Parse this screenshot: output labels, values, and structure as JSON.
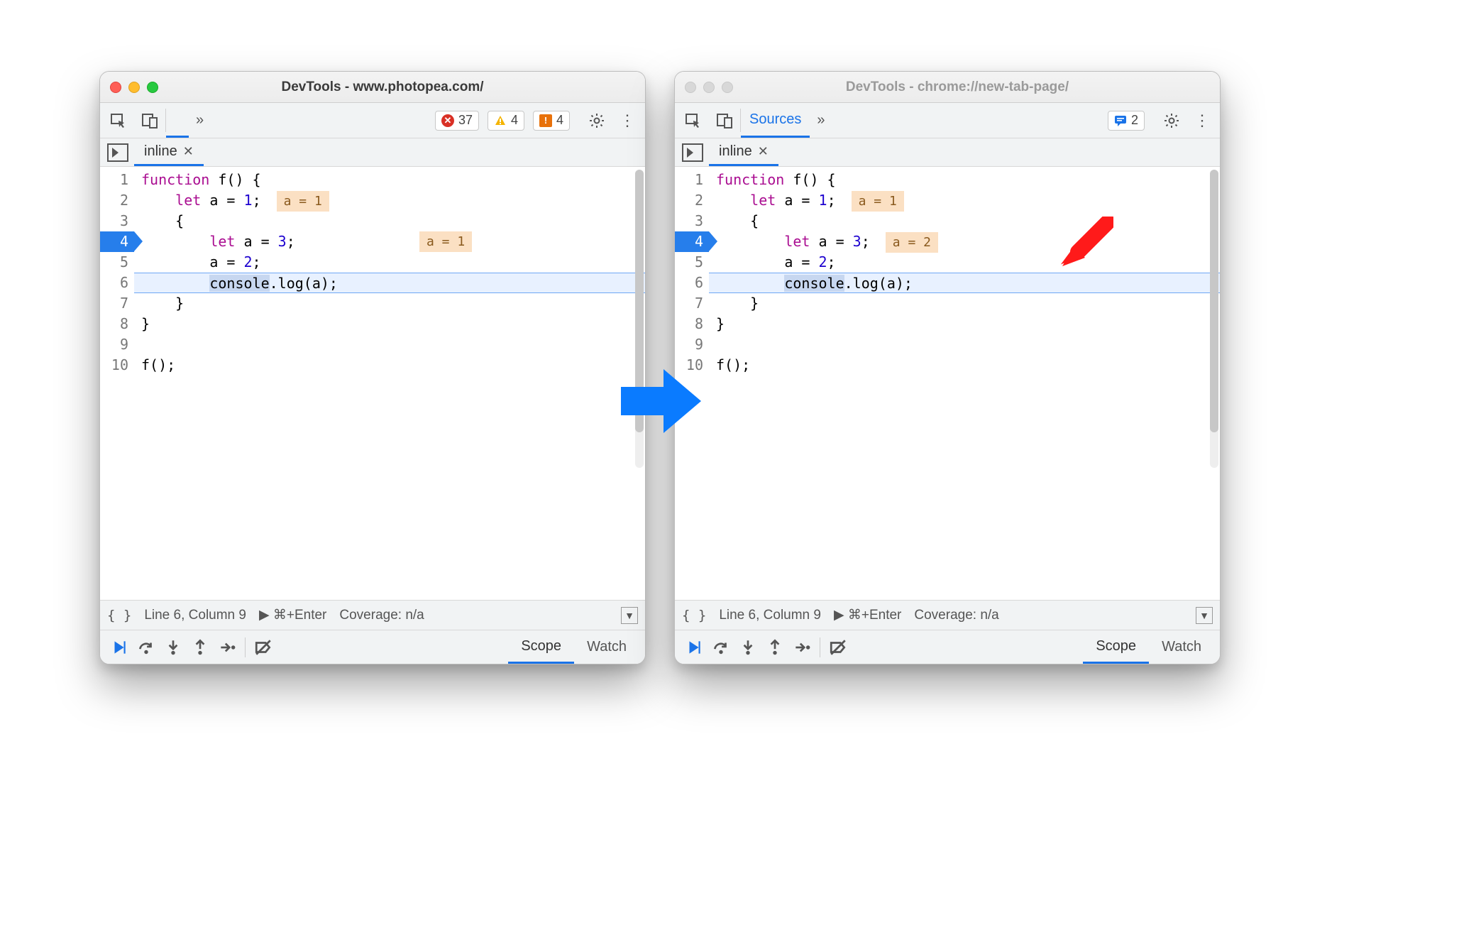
{
  "windows": [
    {
      "active": true,
      "title": "DevTools - www.photopea.com/",
      "toolbar": {
        "show_sources_tab": false,
        "badges": [
          {
            "kind": "err",
            "count": "37"
          },
          {
            "kind": "warn",
            "count": "4"
          },
          {
            "kind": "issue",
            "count": "4"
          }
        ]
      },
      "file_tab": "inline",
      "code": {
        "lines": [
          "1",
          "2",
          "3",
          "4",
          "5",
          "6",
          "7",
          "8",
          "9",
          "10"
        ],
        "bp_line": "4",
        "tok": {
          "kw_function": "function",
          "fn_name": "f",
          "kw_let": "let",
          "v_a": "a",
          "n1": "1",
          "n3": "3",
          "n2": "2",
          "console": "console",
          "log": "log",
          "callarg": "a",
          "call_f": "f"
        },
        "inline_vals": {
          "l2": "a = 1",
          "l4": "a = 1"
        },
        "inline4_far": true
      },
      "status": {
        "pos": "Line 6, Column 9",
        "run": "⌘+Enter",
        "cov": "Coverage: n/a"
      },
      "panels": {
        "scope": "Scope",
        "watch": "Watch"
      }
    },
    {
      "active": false,
      "title": "DevTools - chrome://new-tab-page/",
      "toolbar": {
        "show_sources_tab": true,
        "sources_label": "Sources",
        "badges": [
          {
            "kind": "msg",
            "count": "2"
          }
        ]
      },
      "file_tab": "inline",
      "code": {
        "lines": [
          "1",
          "2",
          "3",
          "4",
          "5",
          "6",
          "7",
          "8",
          "9",
          "10"
        ],
        "bp_line": "4",
        "tok": {
          "kw_function": "function",
          "fn_name": "f",
          "kw_let": "let",
          "v_a": "a",
          "n1": "1",
          "n3": "3",
          "n2": "2",
          "console": "console",
          "log": "log",
          "callarg": "a",
          "call_f": "f"
        },
        "inline_vals": {
          "l2": "a = 1",
          "l4": "a = 2"
        },
        "inline4_far": false
      },
      "status": {
        "pos": "Line 6, Column 9",
        "run": "⌘+Enter",
        "cov": "Coverage: n/a"
      },
      "panels": {
        "scope": "Scope",
        "watch": "Watch"
      }
    }
  ],
  "red_arrow_target": "right"
}
